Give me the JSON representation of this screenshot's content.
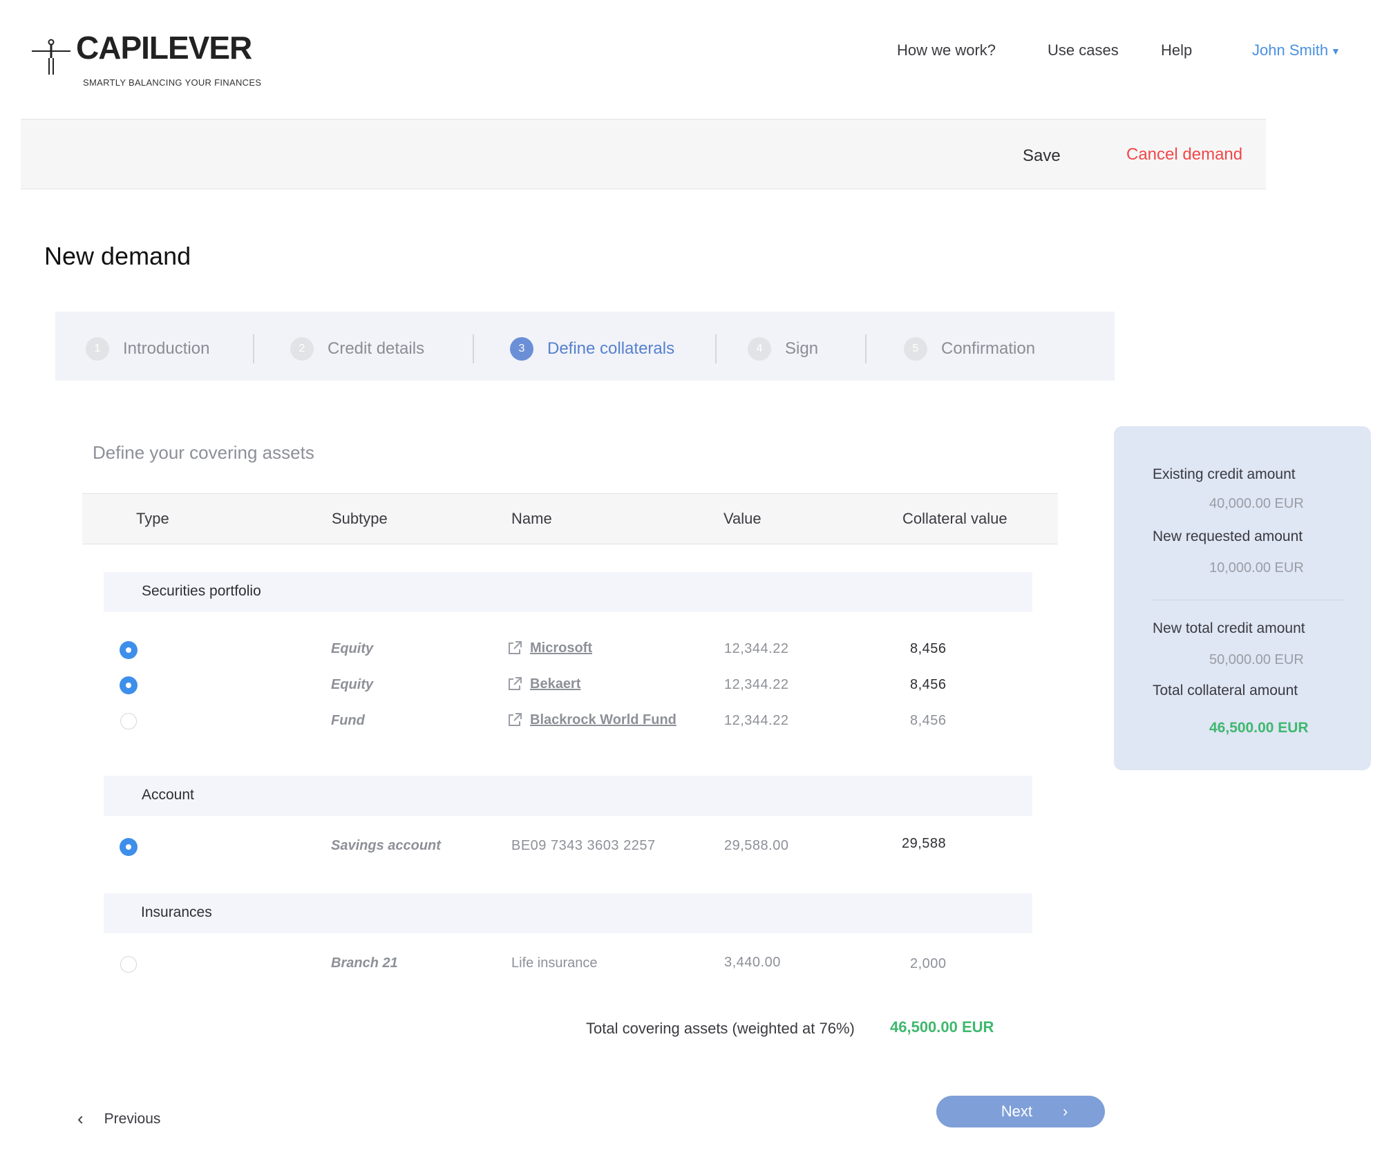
{
  "header": {
    "brand": "CAPILEVER",
    "tagline": "SMARTLY BALANCING YOUR FINANCES",
    "nav": [
      "How we work?",
      "Use cases",
      "Help"
    ],
    "user": "John Smith"
  },
  "actions": {
    "save": "Save",
    "cancel": "Cancel demand"
  },
  "page_title": "New demand",
  "steps": [
    {
      "num": "1",
      "label": "Introduction"
    },
    {
      "num": "2",
      "label": "Credit details"
    },
    {
      "num": "3",
      "label": "Define collaterals"
    },
    {
      "num": "4",
      "label": "Sign"
    },
    {
      "num": "5",
      "label": "Confirmation"
    }
  ],
  "active_step": 3,
  "section_title": "Define your covering assets",
  "table": {
    "columns": [
      "Type",
      "Subtype",
      "Name",
      "Value",
      "Collateral value"
    ],
    "groups": [
      {
        "label": "Securities portfolio",
        "rows": [
          {
            "selected": true,
            "subtype": "Equity",
            "name": "Microsoft",
            "value": "12,344.22",
            "collateral": "8,456"
          },
          {
            "selected": true,
            "subtype": "Equity",
            "name": "Bekaert",
            "value": "12,344.22",
            "collateral": "8,456"
          },
          {
            "selected": false,
            "subtype": "Fund",
            "name": "Blackrock World Fund",
            "value": "12,344.22",
            "collateral": "8,456"
          }
        ]
      },
      {
        "label": "Account",
        "rows": [
          {
            "selected": true,
            "subtype": "Savings account",
            "name": "BE09 7343 3603 2257",
            "value": "29,588.00",
            "collateral": "29,588"
          }
        ]
      },
      {
        "label": "Insurances",
        "rows": [
          {
            "selected": false,
            "subtype": "Branch 21",
            "name": "Life insurance",
            "value": "3,440.00",
            "collateral": "2,000"
          }
        ]
      }
    ],
    "total_label": "Total covering assets (weighted at 76%)",
    "total_value": "46,500.00 EUR"
  },
  "summary": {
    "existing_label": "Existing credit amount",
    "existing_value": "40,000.00 EUR",
    "requested_label": "New requested amount",
    "requested_value": "10,000.00 EUR",
    "new_total_label": "New total credit amount",
    "new_total_value": "50,000.00 EUR",
    "collateral_label": "Total collateral amount",
    "collateral_value": "46,500.00 EUR"
  },
  "footer": {
    "previous": "Previous",
    "next": "Next"
  },
  "colors": {
    "accent": "#4a90e2",
    "danger": "#f04848",
    "success": "#3fb86e",
    "step_active": "#5780cf",
    "next_button": "#7f9fd8"
  },
  "icons": {
    "external_link": "external-link-icon",
    "caret": "caret-down-icon",
    "chevron_left": "chevron-left-icon",
    "chevron_right": "chevron-right-icon"
  }
}
